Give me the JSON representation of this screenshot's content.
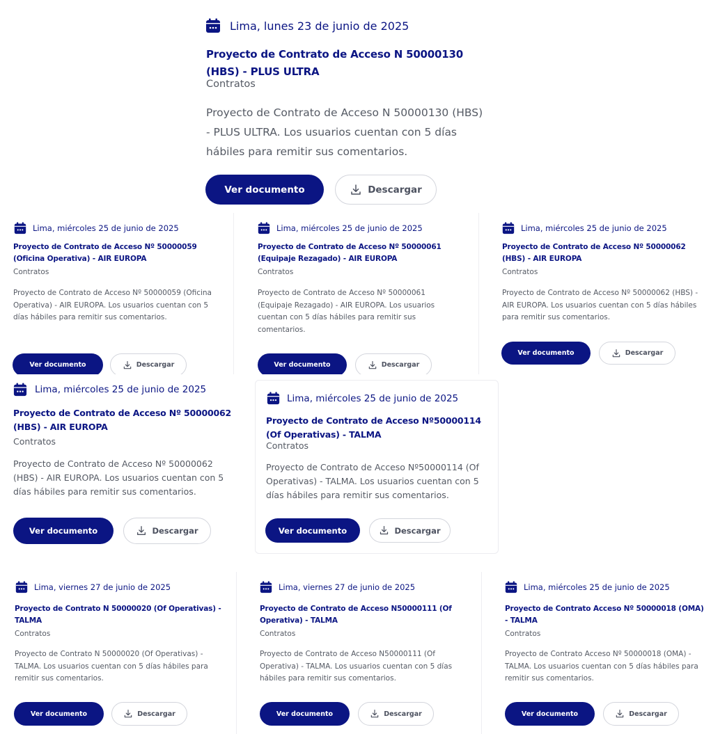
{
  "cards": [
    {
      "date": "Lima, lunes 23 de junio de 2025",
      "title": "Proyecto de Contrato de Acceso N 50000130 (HBS) - PLUS ULTRA",
      "category": "Contratos",
      "description": "Proyecto de Contrato de Acceso N 50000130 (HBS) - PLUS ULTRA. Los usuarios cuentan con 5 días hábiles para remitir sus comentarios.",
      "view_label": "Ver documento",
      "download_label": "Descargar"
    },
    {
      "date": "Lima, miércoles 25 de junio de 2025",
      "title": "Proyecto de Contrato de Acceso Nº 50000059 (Oficina Operativa) - AIR EUROPA",
      "category": "Contratos",
      "description": "Proyecto de Contrato de Acceso Nº 50000059 (Oficina Operativa) - AIR EUROPA. Los usuarios cuentan con 5 días hábiles para remitir sus comentarios.",
      "view_label": "Ver documento",
      "download_label": "Descargar"
    },
    {
      "date": "Lima, miércoles 25 de junio de 2025",
      "title": "Proyecto de Contrato de Acceso Nº 50000061 (Equipaje Rezagado) - AIR EUROPA",
      "category": "Contratos",
      "description": "Proyecto de Contrato de Acceso Nº 50000061 (Equipaje Rezagado) - AIR EUROPA. Los usuarios cuentan con 5 días hábiles para remitir sus comentarios.",
      "view_label": "Ver documento",
      "download_label": "Descargar"
    },
    {
      "date": "Lima, miércoles 25 de junio de 2025",
      "title": "Proyecto de Contrato de Acceso Nº 50000062 (HBS) - AIR EUROPA",
      "category": "Contratos",
      "description": "Proyecto de Contrato de Acceso Nº 50000062 (HBS) - AIR EUROPA. Los usuarios cuentan con 5 días hábiles para remitir sus comentarios.",
      "view_label": "Ver documento",
      "download_label": "Descargar"
    },
    {
      "date": "Lima, miércoles 25 de junio de 2025",
      "title": "Proyecto de Contrato de Acceso Nº 50000062 (HBS) - AIR EUROPA",
      "category": "Contratos",
      "description": "Proyecto de Contrato de Acceso Nº 50000062 (HBS) - AIR EUROPA. Los usuarios cuentan con 5 días hábiles para remitir sus comentarios.",
      "view_label": "Ver documento",
      "download_label": "Descargar"
    },
    {
      "date": "Lima, miércoles 25 de junio de 2025",
      "title": "Proyecto de Contrato de Acceso Nº50000114 (Of Operativas) - TALMA",
      "category": "Contratos",
      "description": "Proyecto de Contrato de Acceso Nº50000114 (Of Operativas) - TALMA. Los usuarios cuentan con 5 días hábiles para remitir sus comentarios.",
      "view_label": "Ver documento",
      "download_label": "Descargar"
    },
    {
      "date": "Lima, viernes 27 de junio de 2025",
      "title": "Proyecto de Contrato N 50000020 (Of Operativas) - TALMA",
      "category": "Contratos",
      "description": "Proyecto de Contrato N 50000020 (Of Operativas) - TALMA. Los usuarios cuentan con 5 días hábiles para remitir sus comentarios.",
      "view_label": "Ver documento",
      "download_label": "Descargar"
    },
    {
      "date": "Lima, viernes 27 de junio de 2025",
      "title": "Proyecto de Contrato de Acceso N50000111 (Of Operativa) - TALMA",
      "category": "Contratos",
      "description": "Proyecto de Contrato de Acceso N50000111 (Of Operativa) - TALMA. Los usuarios cuentan con 5 días hábiles para remitir sus comentarios.",
      "view_label": "Ver documento",
      "download_label": "Descargar"
    },
    {
      "date": "Lima, miércoles 25 de junio de 2025",
      "title": "Proyecto de Contrato Acceso Nº 50000018 (OMA) - TALMA",
      "category": "Contratos",
      "description": "Proyecto de Contrato Acceso Nº 50000018 (OMA) - TALMA. Los usuarios cuentan con 5 días hábiles para remitir sus comentarios.",
      "view_label": "Ver documento",
      "download_label": "Descargar"
    }
  ],
  "icons": {
    "date": "calendar-icon",
    "download": "download-icon"
  },
  "colors": {
    "primary": "#0b1583",
    "text": "#555a64",
    "border": "#d3d5dc"
  }
}
